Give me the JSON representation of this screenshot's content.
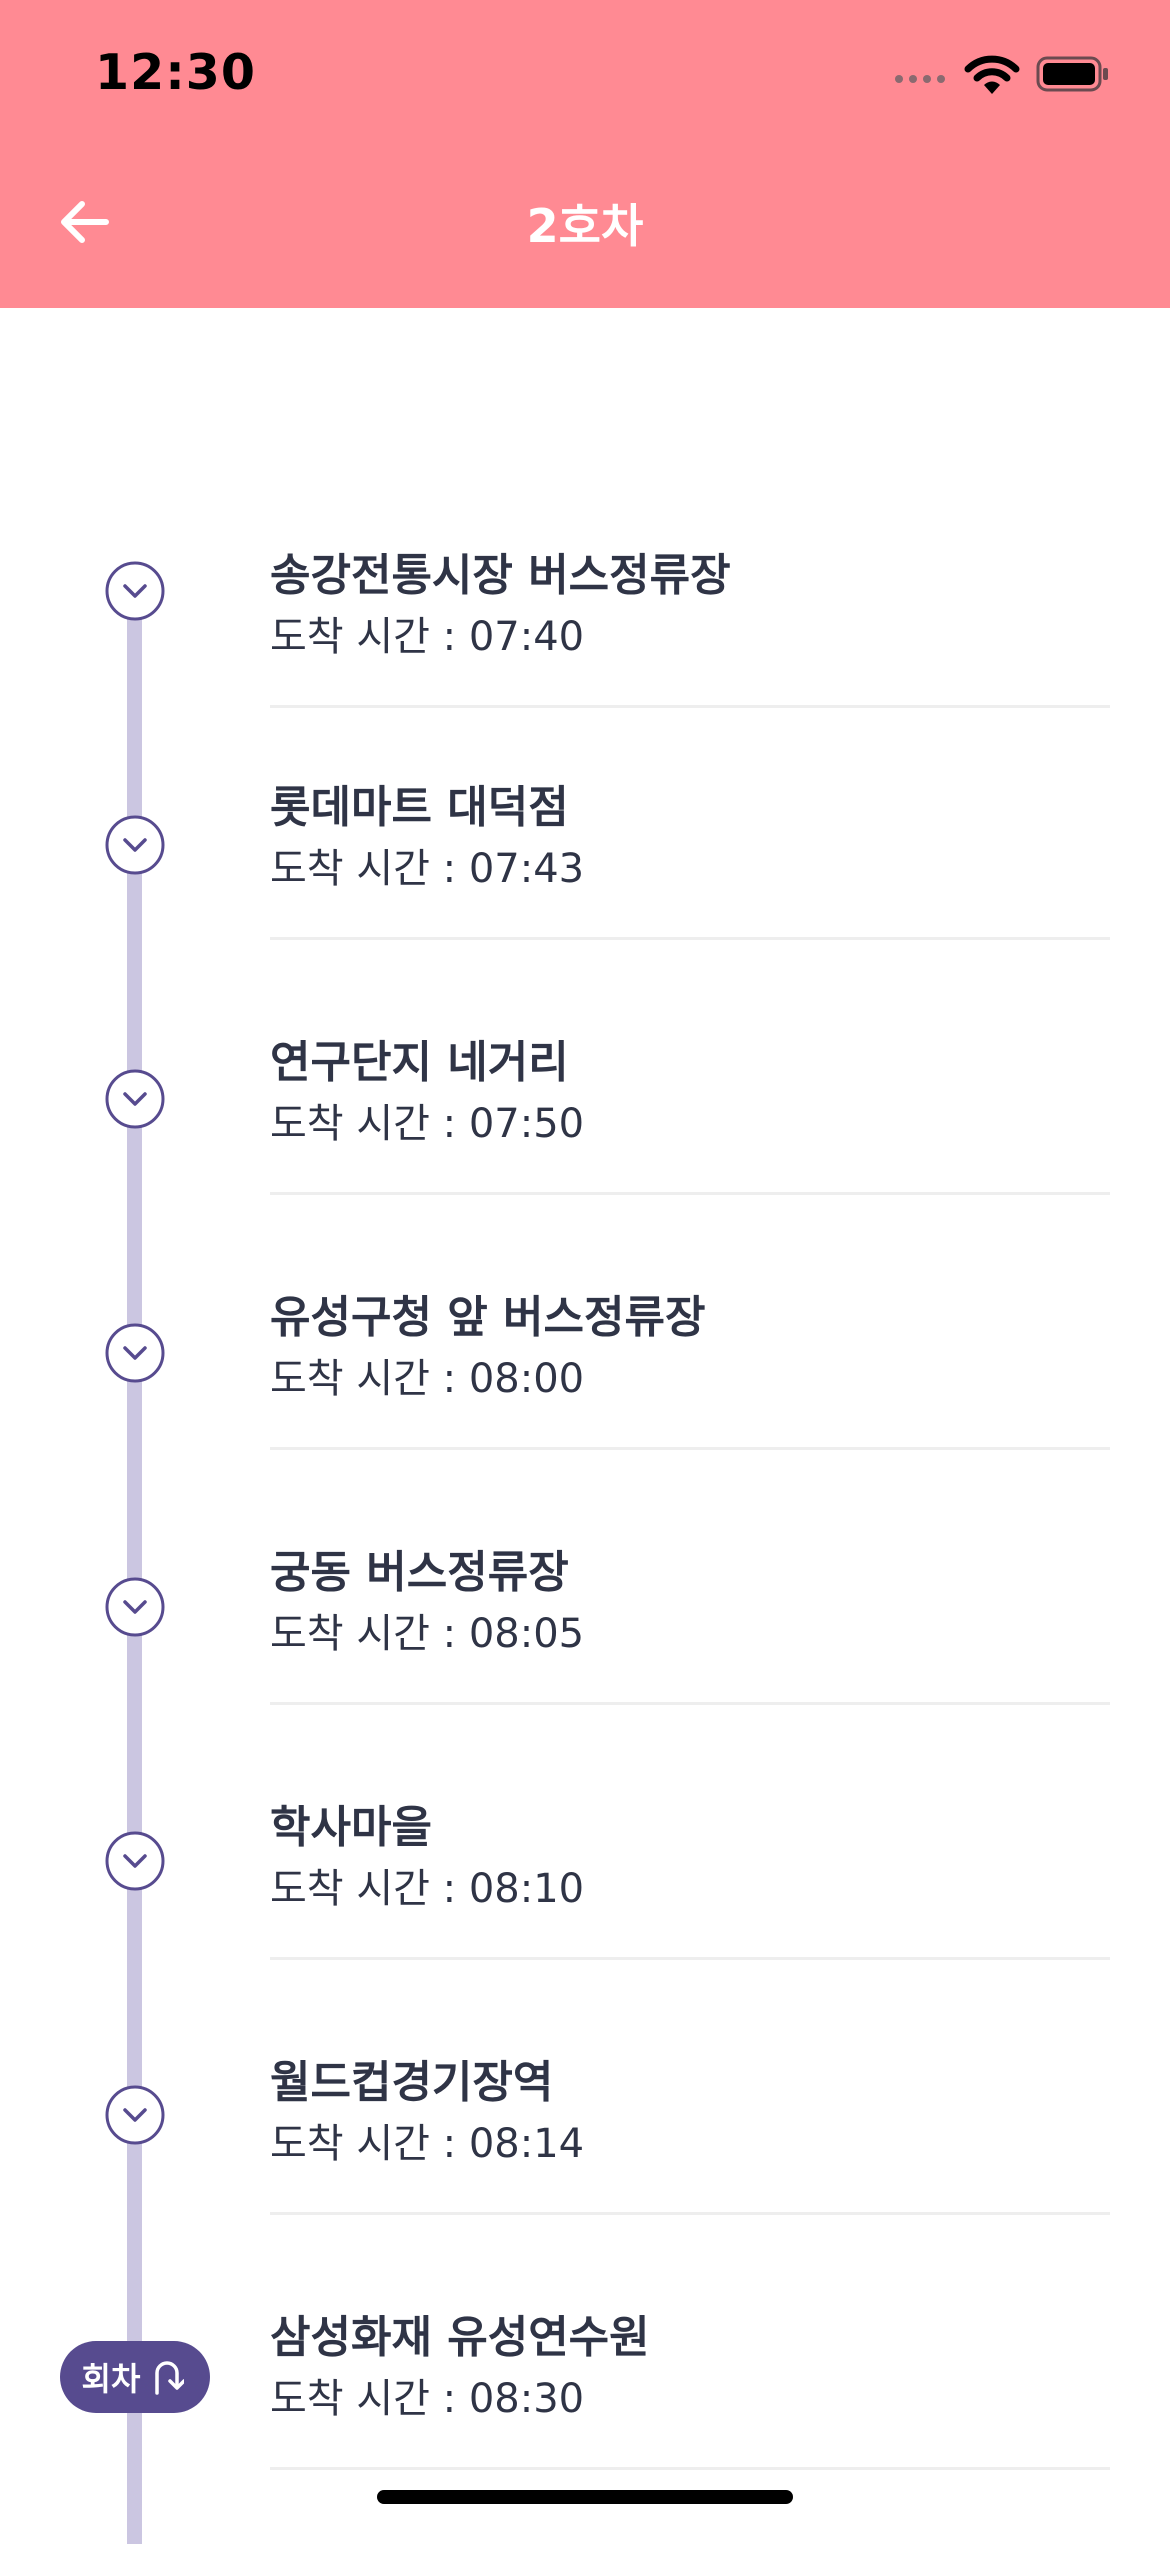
{
  "status_bar": {
    "time": "12:30"
  },
  "header": {
    "title": "2호차",
    "background_color": "#ff8a93"
  },
  "timeline": {
    "stops": [
      {
        "name": "송강전통시장 버스정류장",
        "arrival": "도착 시간 : 07:40"
      },
      {
        "name": "롯데마트 대덕점",
        "arrival": "도착 시간 : 07:43"
      },
      {
        "name": "연구단지 네거리",
        "arrival": "도착 시간 : 07:50"
      },
      {
        "name": "유성구청 앞 버스정류장",
        "arrival": "도착 시간 : 08:00"
      },
      {
        "name": "궁동 버스정류장",
        "arrival": "도착 시간 : 08:05"
      },
      {
        "name": "학사마을",
        "arrival": "도착 시간 : 08:10"
      },
      {
        "name": "월드컵경기장역",
        "arrival": "도착 시간 : 08:14"
      },
      {
        "name": "삼성화재 유성연수원",
        "arrival": "도착 시간 : 08:30"
      }
    ],
    "turn_badge": {
      "label": "회차",
      "icon": "u-turn-icon"
    },
    "rail_color": "#cbc6e1",
    "accent_color": "#574b8f"
  }
}
